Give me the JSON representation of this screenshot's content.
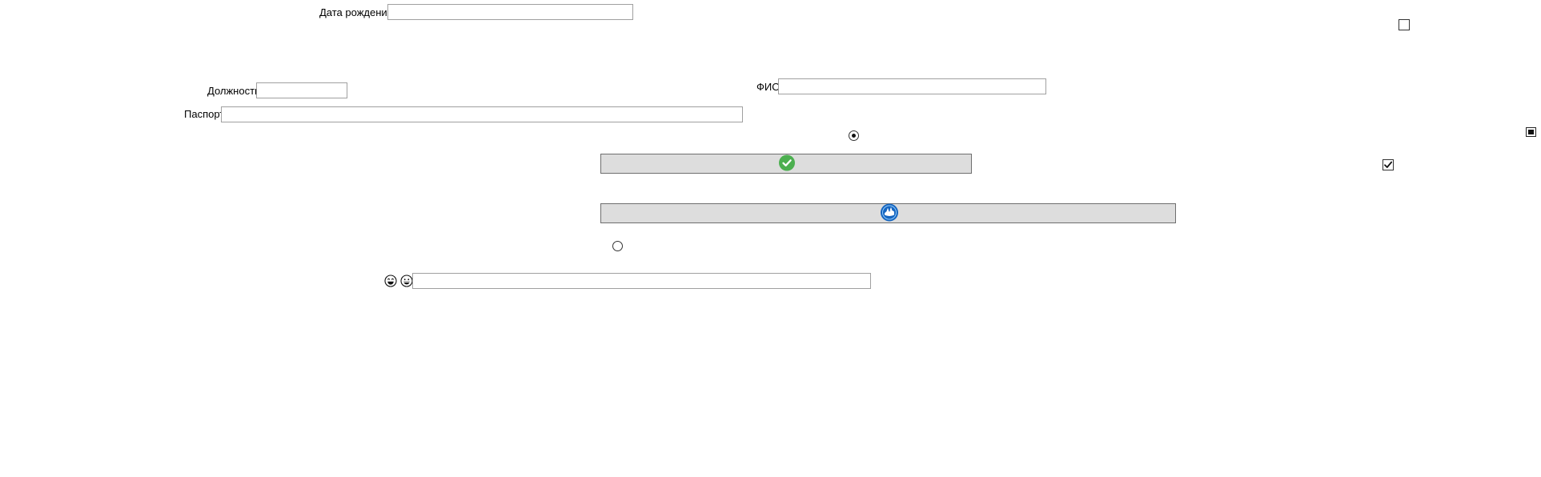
{
  "form": {
    "birth_date_label": "Дата рождения",
    "birth_date_value": "",
    "position_label": "Должность",
    "position_value": "",
    "passport_label": "Паспорт",
    "passport_value": "",
    "fio_label": "ФИО",
    "fio_value": "",
    "search_value": ""
  },
  "controls": {
    "checkbox_top_checked": false,
    "checkbox_right_checked": true,
    "radio_top_selected": true,
    "radio_bottom_selected": false
  },
  "icons": {
    "confirm_button_icon": "check-circle-icon",
    "second_button_icon": "blue-round-icon",
    "emoji_left": "laughing-face-icon",
    "emoji_right": "grinning-face-icon",
    "edge_icon": "small-window-icon"
  },
  "colors": {
    "button_bg": "#dddddd",
    "check_green": "#4caf50",
    "icon_blue": "#1565c0"
  }
}
